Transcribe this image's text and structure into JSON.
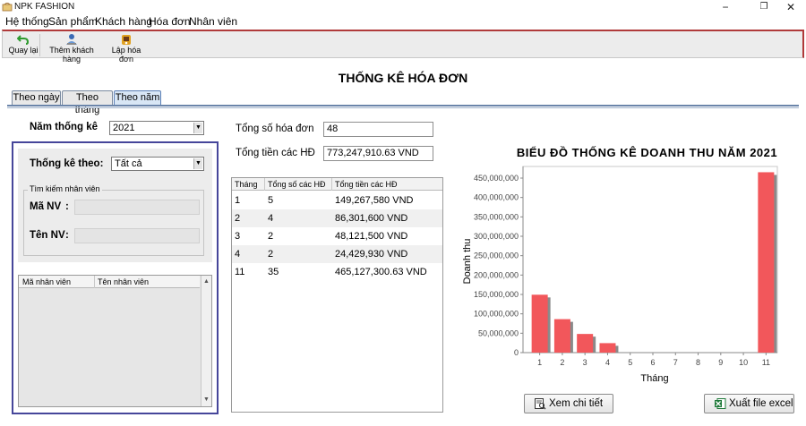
{
  "window": {
    "title": "NPK FASHION",
    "minimize": "−",
    "restore": "❐",
    "close": "✕"
  },
  "menu": [
    "Hệ thống",
    "Sản phẩm",
    "Khách hàng",
    "Hóa đơn",
    "Nhân viên"
  ],
  "toolbar": {
    "back_label": "Quay lại",
    "back_icon": "undo-arrow-icon",
    "add_customer_label": "Thêm khách hàng",
    "add_customer_icon": "add-user-icon",
    "create_invoice_label": "Lập hóa đơn",
    "create_invoice_icon": "invoice-icon"
  },
  "page_title": "THỐNG KÊ HÓA ĐƠN",
  "tabs": [
    {
      "label": "Theo ngày",
      "active": false
    },
    {
      "label": "Theo tháng",
      "active": false
    },
    {
      "label": "Theo năm",
      "active": true
    }
  ],
  "filters": {
    "year_label": "Năm thống kê",
    "year_value": "2021",
    "by_label": "Thống kê theo:",
    "by_value": "Tất cả",
    "search_group": "Tìm kiếm nhân viên",
    "emp_id_label": "Mã NV",
    "emp_name_label": "Tên NV",
    "colon": ":",
    "emp_id_value": "",
    "emp_name_value": ""
  },
  "employee_table": {
    "columns": [
      "Mã nhân viên",
      "Tên nhân viên"
    ],
    "rows": []
  },
  "summary": {
    "total_invoices_label": "Tổng số hóa đơn",
    "total_invoices_value": "48",
    "total_amount_label": "Tổng tiền các HĐ",
    "total_amount_value": "773,247,910.63 VND"
  },
  "monthly_table": {
    "columns": [
      "Tháng",
      "Tổng số các HĐ",
      "Tổng tiền các HĐ"
    ],
    "rows": [
      [
        "1",
        "5",
        "149,267,580 VND"
      ],
      [
        "2",
        "4",
        "86,301,600 VND"
      ],
      [
        "3",
        "2",
        "48,121,500 VND"
      ],
      [
        "4",
        "2",
        "24,429,930 VND"
      ],
      [
        "11",
        "35",
        "465,127,300.63 VND"
      ]
    ]
  },
  "chart_data": {
    "type": "bar",
    "title": "BIỂU ĐỒ THỐNG KÊ DOANH THU NĂM 2021",
    "xlabel": "Tháng",
    "ylabel": "Doanh thu",
    "categories": [
      "1",
      "2",
      "3",
      "4",
      "5",
      "6",
      "7",
      "8",
      "9",
      "10",
      "11"
    ],
    "values": [
      149267580,
      86301600,
      48121500,
      24429930,
      0,
      0,
      0,
      0,
      0,
      0,
      465127300.63
    ],
    "yticks": [
      0,
      50000000,
      100000000,
      150000000,
      200000000,
      250000000,
      300000000,
      350000000,
      400000000,
      450000000
    ],
    "ytick_labels": [
      "0",
      "50,000,000",
      "100,000,000",
      "150,000,000",
      "200,000,000",
      "250,000,000",
      "300,000,000",
      "350,000,000",
      "400,000,000",
      "450,000,000"
    ],
    "ylim": [
      0,
      480000000
    ],
    "bar_color": "#f2575b",
    "grid": false,
    "legend": false
  },
  "buttons": {
    "detail_label": "Xem chi tiết",
    "detail_icon": "document-search-icon",
    "export_label": "Xuất file excel",
    "export_icon": "excel-icon"
  },
  "colors": {
    "toolbar_accent": "#b03a3a",
    "panel_border": "#46469a",
    "active_tab": "#d8e6f5"
  }
}
